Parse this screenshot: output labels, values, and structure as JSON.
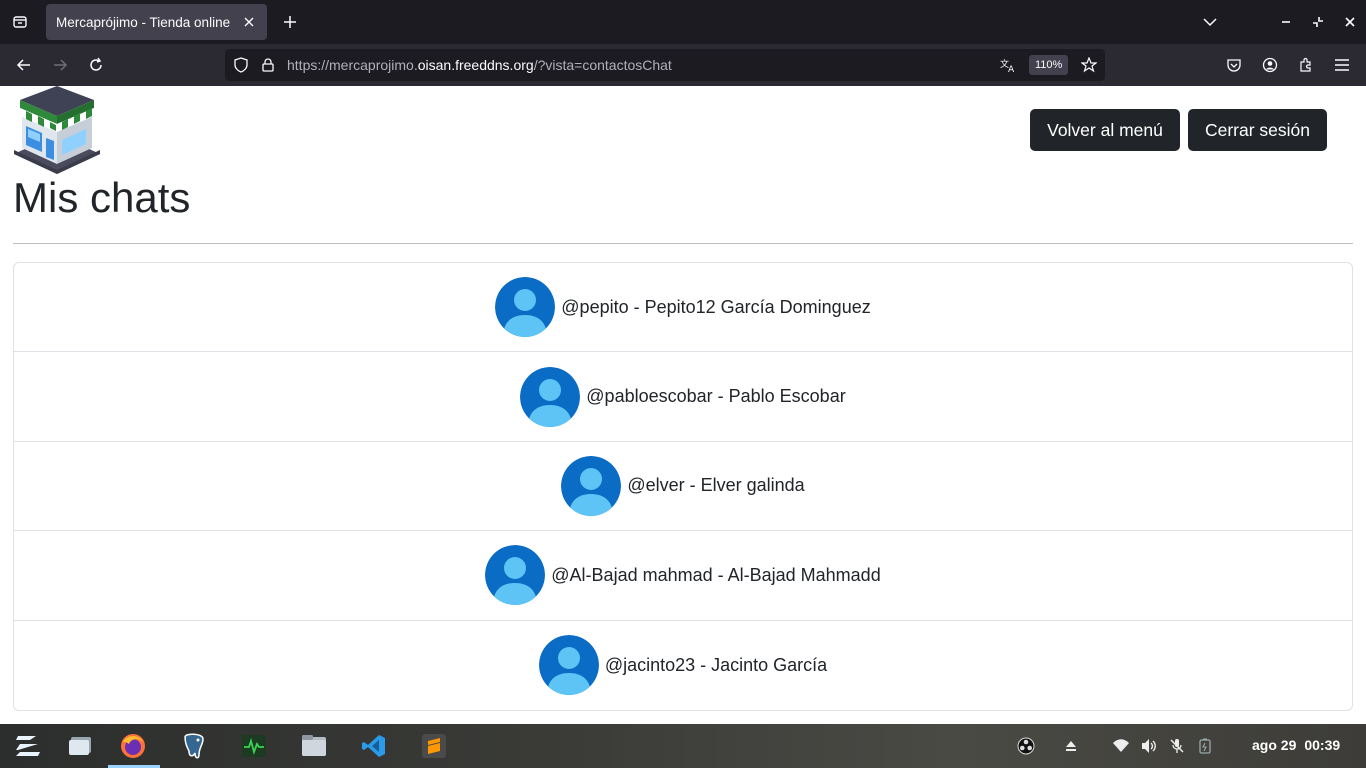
{
  "browser": {
    "tab_title": "Mercaprójimo - Tienda online",
    "url_prefix": "https://mercaprojimo.",
    "url_host": "oisan.freeddns.org",
    "url_path": "/?vista=contactosChat",
    "zoom": "110%"
  },
  "header": {
    "back_menu_label": "Volver al menú",
    "logout_label": "Cerrar sesión"
  },
  "page_title": "Mis chats",
  "chats": [
    {
      "label": "@pepito - Pepito12 García Dominguez"
    },
    {
      "label": "@pabloescobar - Pablo Escobar"
    },
    {
      "label": "@elver - Elver galinda"
    },
    {
      "label": "@Al-Bajad mahmad - Al-Bajad Mahmadd"
    },
    {
      "label": "@jacinto23 - Jacinto García"
    }
  ],
  "taskbar": {
    "date": "ago 29",
    "time": "00:39"
  },
  "colors": {
    "button_dark": "#212529",
    "avatar_blue": "#0a6cc4",
    "browser_bg": "#1c1b22"
  }
}
